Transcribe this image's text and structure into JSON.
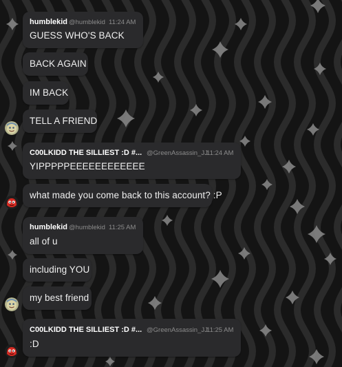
{
  "chat": {
    "messages": [
      {
        "name": "humblekid",
        "handle": "@humblekid",
        "time": "11:24 AM",
        "text": "GUESS WHO'S BACK"
      },
      {
        "text": "BACK AGAIN"
      },
      {
        "text": "IM BACK"
      },
      {
        "text": "TELL A FRIEND"
      },
      {
        "name": "C00LKIDD THE SILLIEST :D #...",
        "handle": "@GreenAssassin_JJ",
        "time": "11:24 AM",
        "text": "YIPPPPPEEEEEEEEEEEE"
      },
      {
        "text": "what made you come back to this account? :P"
      },
      {
        "name": "humblekid",
        "handle": "@humblekid",
        "time": "11:25 AM",
        "text": "all of u"
      },
      {
        "text": "including YOU"
      },
      {
        "text": "my best friend"
      },
      {
        "name": "C00LKIDD THE SILLIEST :D #...",
        "handle": "@GreenAssassin_JJ",
        "time": "11:25 AM",
        "text": ":D"
      }
    ],
    "avatars": [
      {
        "user": "humblekid",
        "icon": "cartoon-face-avatar-icon"
      },
      {
        "user": "C00LKIDD THE SILLIEST",
        "icon": "red-creature-avatar-icon"
      },
      {
        "user": "humblekid",
        "icon": "cartoon-face-avatar-icon"
      },
      {
        "user": "C00LKIDD THE SILLIEST",
        "icon": "red-creature-avatar-icon"
      }
    ]
  },
  "colors": {
    "background": "#141414",
    "wave": "#2b2b2b",
    "bubble": "#2a2a2c",
    "text": "#f0f0f0",
    "meta": "#8c8c8c",
    "sparkle": "#8a8a8a"
  }
}
